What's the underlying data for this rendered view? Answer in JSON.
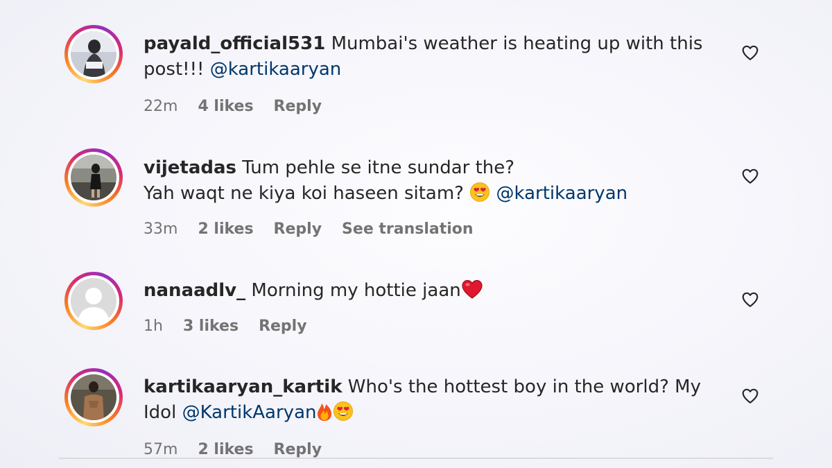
{
  "comments": [
    {
      "username": "payald_official531",
      "text": "Mumbai's weather is heating up with this post!!!",
      "mention": "@kartikaaryan",
      "time": "22m",
      "likes": "4 likes",
      "reply": "Reply"
    },
    {
      "username": "vijetadas",
      "text_line1": "Tum pehle se itne sundar the?",
      "text_line2": "Yah waqt ne kiya koi haseen sitam?",
      "mention": "@kartikaaryan",
      "time": "33m",
      "likes": "2 likes",
      "reply": "Reply",
      "translation": "See translation"
    },
    {
      "username": "nanaadlv_",
      "text": "Morning my hottie jaan",
      "time": "1h",
      "likes": "3 likes",
      "reply": "Reply"
    },
    {
      "username": "kartikaaryan_kartik",
      "text": "Who's the hottest boy in the world? My Idol",
      "mention": "@KartikAaryan",
      "time": "57m",
      "likes": "2 likes",
      "reply": "Reply"
    }
  ],
  "colors": {
    "username": "#262626",
    "mention": "#00376b",
    "meta": "#737373"
  },
  "icons": {
    "like": "heart-outline-icon"
  }
}
